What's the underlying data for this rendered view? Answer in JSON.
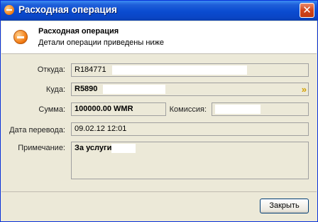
{
  "window": {
    "title": "Расходная операция",
    "close_glyph": "✕"
  },
  "header": {
    "title": "Расходная операция",
    "subtitle": "Детали операции приведены ниже",
    "icon": "minus-circle-icon"
  },
  "form": {
    "from_label": "Откуда:",
    "from_value": "R184771",
    "to_label": "Куда:",
    "to_value": "R5890",
    "sum_label": "Сумма:",
    "sum_value": "100000.00 WMR",
    "commission_label": "Комиссия:",
    "commission_value": "",
    "date_label": "Дата перевода:",
    "date_value": "09.02.12 12:01",
    "note_label": "Примечание:",
    "note_value": "За услуги"
  },
  "buttons": {
    "close_label": "Закрыть"
  },
  "colors": {
    "titlebar": "#0a4bd0",
    "window_bg": "#ece9d8",
    "accent_icon": "#f07a10"
  }
}
